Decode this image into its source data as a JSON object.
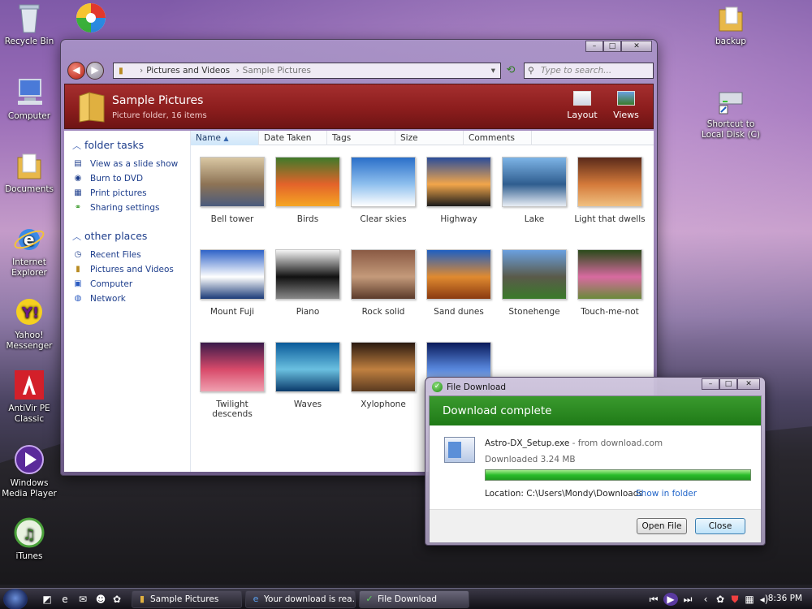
{
  "desktop": {
    "icons": [
      {
        "label": "Recycle Bin",
        "icon": "recycle-bin-icon"
      },
      {
        "label": "Computer",
        "icon": "computer-icon"
      },
      {
        "label": "Documents",
        "icon": "documents-folder-icon"
      },
      {
        "label": "Internet Explorer",
        "icon": "internet-explorer-icon"
      },
      {
        "label": "Yahoo! Messenger",
        "icon": "yahoo-messenger-icon"
      },
      {
        "label": "AntiVir PE Classic",
        "icon": "antivir-icon"
      },
      {
        "label": "Windows Media Player",
        "icon": "media-player-icon"
      },
      {
        "label": "iTunes",
        "icon": "itunes-icon"
      },
      {
        "label": "backup",
        "icon": "folder-icon"
      },
      {
        "label": "Shortcut to Local Disk (C)",
        "icon": "drive-shortcut-icon"
      }
    ]
  },
  "explorer": {
    "breadcrumb": [
      "Pictures and Videos",
      "Sample Pictures"
    ],
    "search_placeholder": "Type to search...",
    "title": "Sample Pictures",
    "subtitle": "Picture folder, 16 items",
    "toolbar": {
      "layout": "Layout",
      "views": "Views"
    },
    "sidebar": {
      "folder_tasks_heading": "folder tasks",
      "folder_tasks": [
        "View as a slide show",
        "Burn to DVD",
        "Print pictures",
        "Sharing settings"
      ],
      "other_places_heading": "other places",
      "other_places": [
        "Recent Files",
        "Pictures and Videos",
        "Computer",
        "Network"
      ]
    },
    "columns": [
      "Name",
      "Date Taken",
      "Tags",
      "Size",
      "Comments"
    ],
    "items": [
      {
        "name": "Bell tower",
        "colors": [
          "#d9c7a3",
          "#8d7355",
          "#4a5b7d"
        ]
      },
      {
        "name": "Birds",
        "colors": [
          "#3f7a2a",
          "#e3632a",
          "#f5a623"
        ]
      },
      {
        "name": "Clear skies",
        "colors": [
          "#2a6fc9",
          "#8fc0ee",
          "#ffffff"
        ]
      },
      {
        "name": "Highway",
        "colors": [
          "#2a4d9a",
          "#f2a64a",
          "#1b1b1b"
        ]
      },
      {
        "name": "Lake",
        "colors": [
          "#7db4e6",
          "#2f5d8f",
          "#e9eef5"
        ]
      },
      {
        "name": "Light that dwells",
        "colors": [
          "#5a2a1a",
          "#d47a3a",
          "#f0c080"
        ]
      },
      {
        "name": "Mount Fuji",
        "colors": [
          "#2f63c8",
          "#ffffff",
          "#1b3a78"
        ]
      },
      {
        "name": "Piano",
        "colors": [
          "#f4f4f4",
          "#111111",
          "#888888"
        ]
      },
      {
        "name": "Rock solid",
        "colors": [
          "#8a5a44",
          "#c49a7a",
          "#5a3a2a"
        ]
      },
      {
        "name": "Sand dunes",
        "colors": [
          "#1e5fc2",
          "#e08a30",
          "#8a3a10"
        ]
      },
      {
        "name": "Stonehenge",
        "colors": [
          "#6aa0e0",
          "#5a5a4a",
          "#3a7a2a"
        ]
      },
      {
        "name": "Touch-me-not",
        "colors": [
          "#2a4a1a",
          "#d86aa0",
          "#6a8a3a"
        ]
      },
      {
        "name": "Twilight descends",
        "colors": [
          "#3a1a4a",
          "#d84a6a",
          "#f0a0b0"
        ]
      },
      {
        "name": "Waves",
        "colors": [
          "#0a5a9a",
          "#6ac0e0",
          "#0a3a6a"
        ]
      },
      {
        "name": "Xylophone",
        "colors": [
          "#2a1a10",
          "#c08040",
          "#5a3a20"
        ]
      },
      {
        "name": "",
        "colors": [
          "#0a1a5a",
          "#5a8ae0",
          "#dbe8ff"
        ]
      }
    ]
  },
  "download": {
    "window_title": "File Download",
    "heading": "Download complete",
    "filename": "Astro-DX_Setup.exe",
    "source": " - from download.com",
    "size_text": "Downloaded 3.24 MB",
    "progress": 1.0,
    "location": "Location: C:\\Users\\Mondy\\Downloads",
    "show_in_folder": "Show in folder",
    "open_label": "Open File",
    "close_label": "Close"
  },
  "taskbar": {
    "buttons": [
      "Sample Pictures",
      "Your download is rea...",
      "File Download"
    ],
    "clock": "8:36 PM"
  },
  "colors": {
    "header_red": "#8c1d1d",
    "download_green": "#2a8a22",
    "link_blue": "#1e3e8c"
  }
}
